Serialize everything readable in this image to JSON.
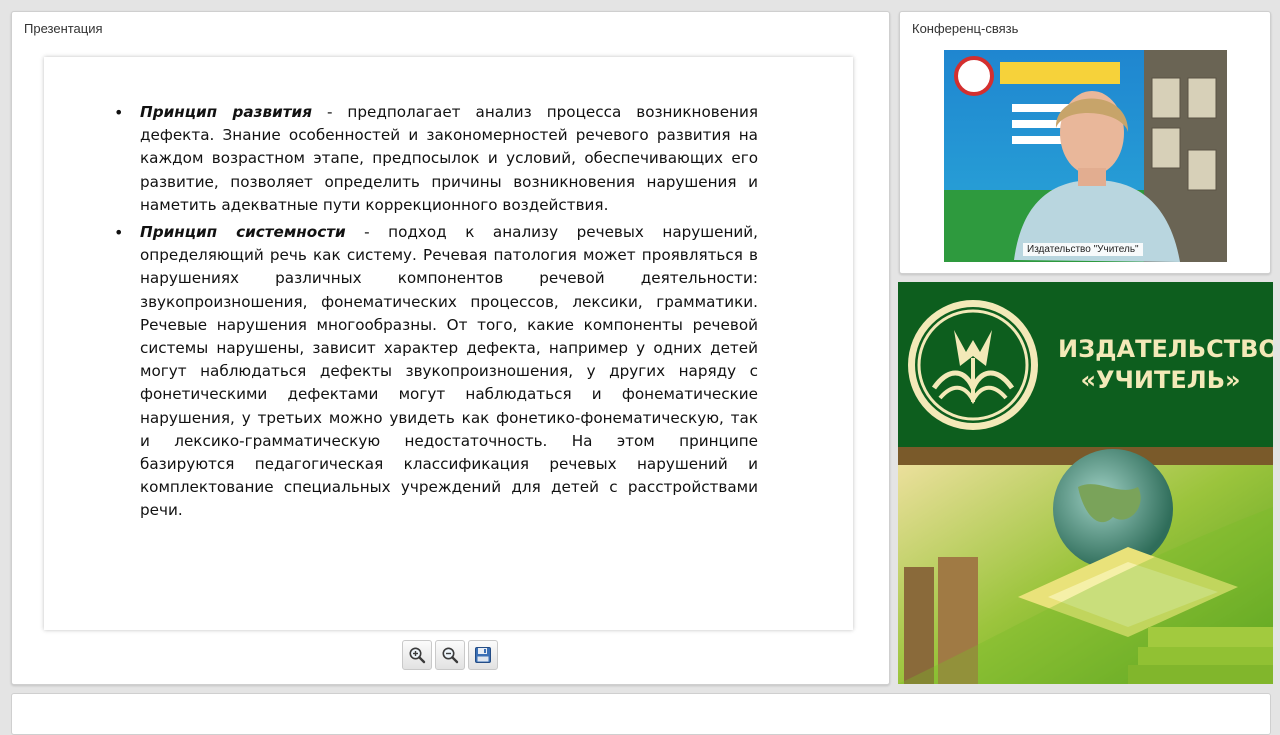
{
  "presentation": {
    "title": "Презентация",
    "bullets": [
      {
        "term": "Принцип развития",
        "text": " - предполагает анализ процесса возникновения дефекта. Знание особенностей и закономерностей речевого развития на каждом возрастном этапе, предпосылок и условий, обеспечивающих его развитие, позволяет определить причины возникновения нарушения и наметить адекватные пути коррекционного воздействия."
      },
      {
        "term": "Принцип системности",
        "text": " - подход к анализу речевых нарушений, определяющий речь как систему. Речевая патология может проявляться в нарушениях различных компонентов речевой деятельности: звукопроизношения, фонематических процессов, лексики, грамматики. Речевые нарушения многообразны. От того, какие компоненты речевой системы нарушены, зависит характер дефекта, например у одних детей могут наблюдаться дефекты звукопроизношения, у других наряду с фонетическими дефектами могут наблюдаться и фонематические нарушения, у третьих можно увидеть как фонетико-фонематическую, так и лексико-грамматическую недостаточность. На этом принципе базируются педагогическая классификация речевых нарушений и комплектование специальных учреждений для детей с расстройствами речи."
      }
    ],
    "toolbar": {
      "zoom_in_icon": "zoom-in-icon",
      "zoom_out_icon": "zoom-out-icon",
      "save_icon": "floppy-disk-icon"
    }
  },
  "conference": {
    "title": "Конференц-связь",
    "speaker_label": "Издательство \"Учитель\""
  },
  "banner": {
    "publisher_line1": "ИЗДАТЕЛЬСТВО",
    "publisher_line2": "«УЧИТЕЛЬ»",
    "colors": {
      "green": "#0d5e1e",
      "gold": "#f3e9b8"
    }
  }
}
